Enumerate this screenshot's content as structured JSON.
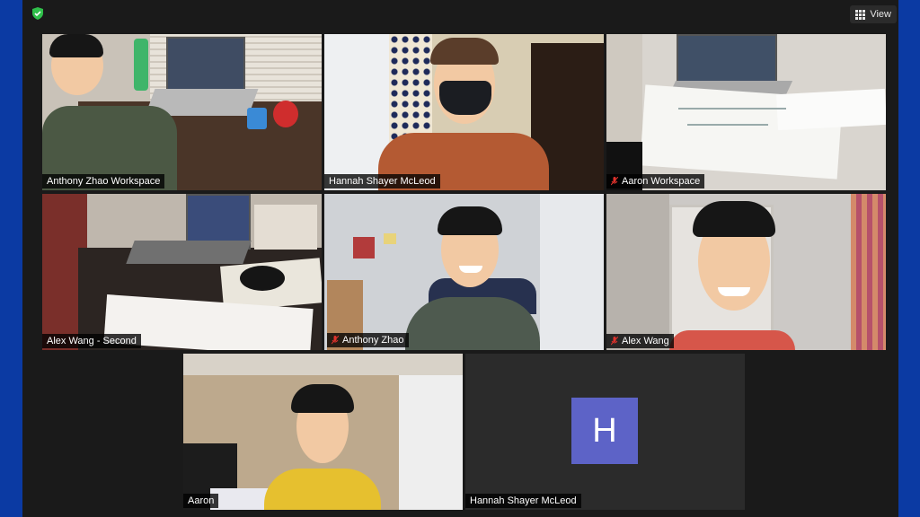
{
  "toolbar": {
    "view_label": "View",
    "shield_color": "#2fbf4a"
  },
  "tiles": [
    {
      "name": "Anthony Zhao Workspace",
      "muted": false,
      "active": false
    },
    {
      "name": "Hannah Shayer McLeod",
      "muted": false,
      "active": false
    },
    {
      "name": "Aaron Workspace",
      "muted": true,
      "active": false
    },
    {
      "name": "Alex Wang - Second",
      "muted": false,
      "active": false
    },
    {
      "name": "Anthony Zhao",
      "muted": true,
      "active": true
    },
    {
      "name": "Alex Wang",
      "muted": true,
      "active": false
    },
    {
      "name": "Aaron",
      "muted": false,
      "active": false
    },
    {
      "name": "Hannah Shayer McLeod",
      "muted": false,
      "active": false,
      "avatar_letter": "H"
    }
  ],
  "colors": {
    "active_border": "#d7e36c",
    "avatar_bg": "#5d63c7",
    "muted_icon": "#e0322c"
  }
}
